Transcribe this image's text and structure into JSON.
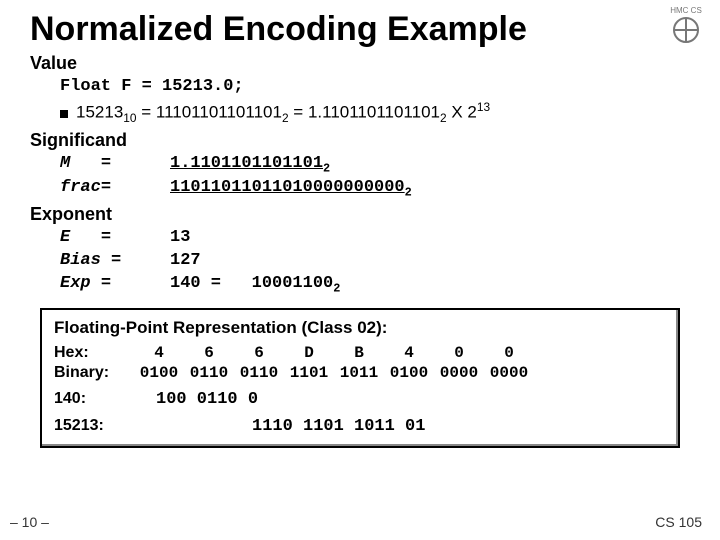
{
  "title": "Normalized Encoding Example",
  "sections": {
    "value": {
      "head": "Value",
      "decl": "Float F = 15213.0;",
      "bullet_a": "15213",
      "bullet_a_sub": "10",
      "bullet_b": " = 11101101101101",
      "bullet_b_sub": "2",
      "bullet_c": " = 1.1101101101101",
      "bullet_c_sub": "2",
      "bullet_d": " X 2",
      "bullet_d_sup": "13"
    },
    "significand": {
      "head": "Significand",
      "m_lab": "M",
      "m_eq": "=",
      "m_val": "1.1101101101101",
      "m_sub": "2",
      "frac_lab": "frac",
      "frac_eq": "=",
      "frac_val": " 11011011011010000000000",
      "frac_sub": "2"
    },
    "exponent": {
      "head": "Exponent",
      "e_lab": "E",
      "e_eq": "=",
      "e_val": "13",
      "bias_lab": "Bias",
      "bias_eq": "=",
      "bias_val": "127",
      "exp_lab": "Exp",
      "exp_eq": "=",
      "exp_val": "140  =",
      "exp_bin": "10001100",
      "exp_bin_sub": "2"
    },
    "fp": {
      "head": "Floating-Point Representation (Class 02):",
      "hex_lab": "Hex:",
      "hex_g0": "4",
      "hex_g1": "6",
      "hex_g2": "6",
      "hex_g3": "D",
      "hex_g4": "B",
      "hex_g5": "4",
      "hex_g6": "0",
      "hex_g7": "0",
      "bin_lab": "Binary:",
      "bin_g0": "0100",
      "bin_g1": "0110",
      "bin_g2": "0110",
      "bin_g3": "1101",
      "bin_g4": "1011",
      "bin_g5": "0100",
      "bin_g6": "0000",
      "bin_g7": "0000",
      "n140_lab": "140:",
      "n140_val": "100 0110 0",
      "n15213_lab": "15213:",
      "n15213_val": "1110 1101 1011 01"
    }
  },
  "page": "– 10 –",
  "course": "CS 105",
  "logo_text": "HMC CS"
}
